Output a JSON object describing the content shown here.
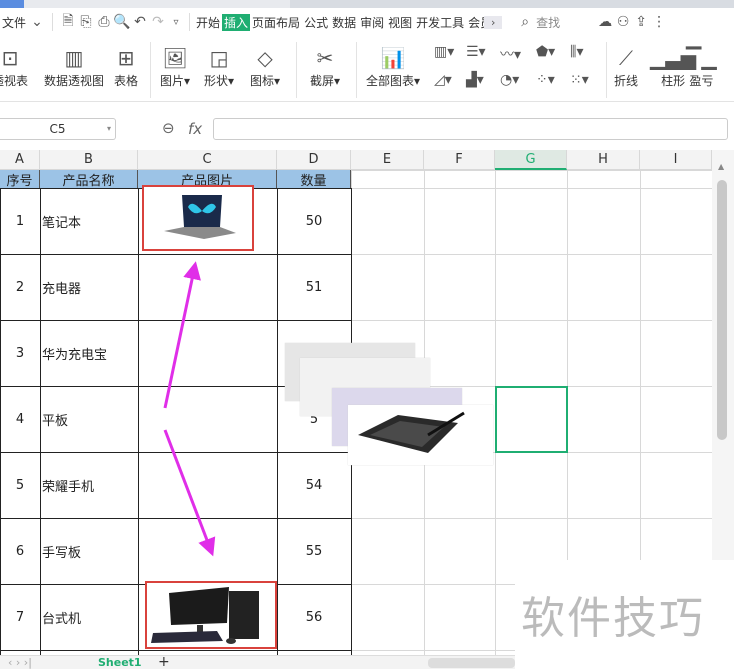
{
  "menubar": {
    "file": "文件",
    "tabs": [
      "开始",
      "插入",
      "页面布局",
      "公式",
      "数据",
      "审阅",
      "视图",
      "开发工具",
      "会员"
    ],
    "active_tab": "插入",
    "search": "查找"
  },
  "ribbon": {
    "items": [
      "透视表",
      "数据透视图",
      "表格",
      "图片",
      "形状",
      "图标",
      "截屏",
      "全部图表",
      "折线",
      "柱形",
      "盈亏"
    ]
  },
  "formula_bar": {
    "cell_ref": "C5",
    "fx": "fx",
    "value": ""
  },
  "columns": [
    "A",
    "B",
    "C",
    "D",
    "E",
    "F",
    "G",
    "H",
    "I"
  ],
  "selected_column": "G",
  "headers": [
    "序号",
    "产品名称",
    "产品图片",
    "数量"
  ],
  "rows": [
    {
      "no": "1",
      "name": "笔记本",
      "qty": "50"
    },
    {
      "no": "2",
      "name": "充电器",
      "qty": "51"
    },
    {
      "no": "3",
      "name": "华为充电宝",
      "qty": ""
    },
    {
      "no": "4",
      "name": "平板",
      "qty": "5"
    },
    {
      "no": "5",
      "name": "荣耀手机",
      "qty": "54"
    },
    {
      "no": "6",
      "name": "手写板",
      "qty": "55"
    },
    {
      "no": "7",
      "name": "台式机",
      "qty": "56"
    }
  ],
  "sheet_tab": "Sheet1",
  "watermark": "软件技巧",
  "colors": {
    "accent": "#1fae72",
    "header_fill": "#9cc3e6",
    "highlight": "#d9423c",
    "arrow": "#e02ee8"
  }
}
